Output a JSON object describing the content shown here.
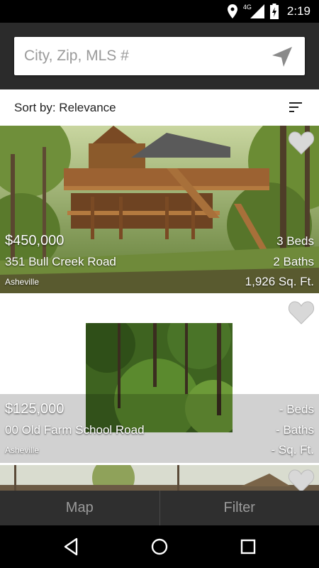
{
  "status": {
    "time": "2:19",
    "network": "4G"
  },
  "search": {
    "placeholder": "City, Zip, MLS #"
  },
  "sort": {
    "label": "Sort by: Relevance"
  },
  "listings": [
    {
      "price": "$450,000",
      "address": "351 Bull Creek Road",
      "city": "Asheville",
      "beds": "3 Beds",
      "baths": "2 Baths",
      "sqft": "1,926 Sq. Ft."
    },
    {
      "price": "$125,000",
      "address": "00 Old Farm School Road",
      "city": "Asheville",
      "beds": "- Beds",
      "baths": "- Baths",
      "sqft": "- Sq. Ft."
    }
  ],
  "tabs": {
    "map": "Map",
    "filter": "Filter"
  },
  "colors": {
    "topbar": "#2b2b2b",
    "bottombar": "#2f2f2f",
    "statusbar": "#000000"
  },
  "icons": [
    "location-pin-icon",
    "signal-icon",
    "battery-icon",
    "locate-arrow-icon",
    "sort-lines-icon",
    "heart-icon",
    "back-icon",
    "home-icon",
    "recents-icon"
  ]
}
